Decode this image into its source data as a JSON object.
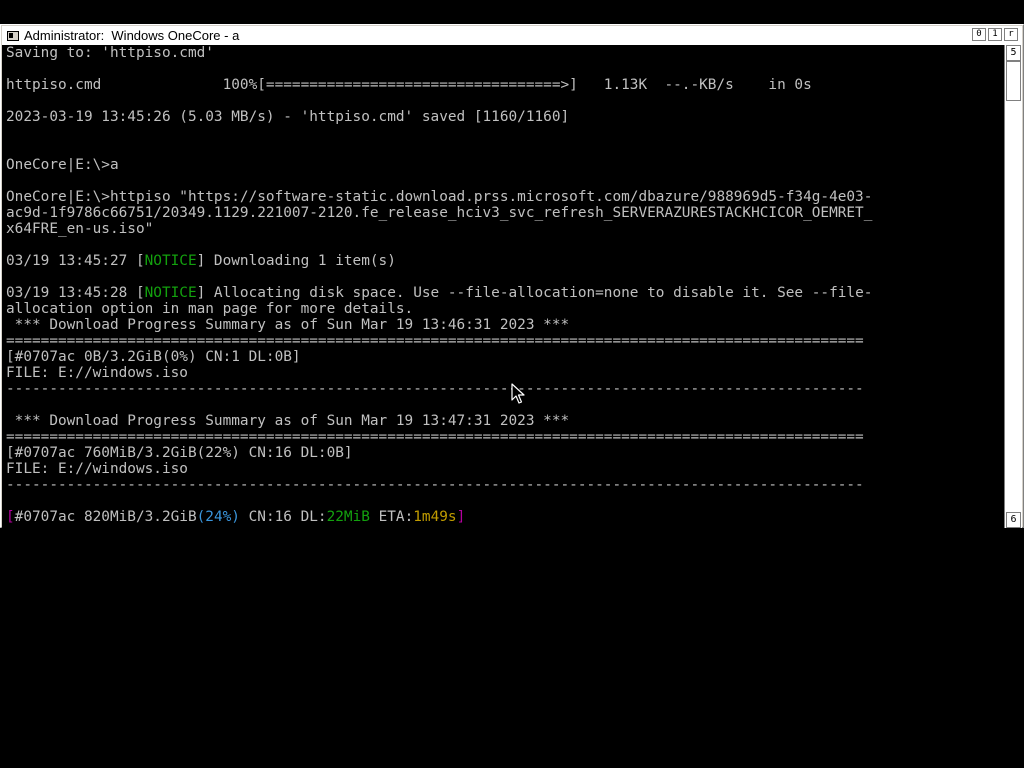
{
  "window": {
    "title": "Administrator:  Windows OneCore - a",
    "buttons": {
      "minimize": "0",
      "maximize": "1",
      "close": "r"
    },
    "scrollbar": {
      "up": "5",
      "down": "6"
    }
  },
  "console": {
    "lines": [
      [
        {
          "t": "Saving to: 'httpiso.cmd'"
        }
      ],
      [
        {
          "t": ""
        }
      ],
      [
        {
          "t": "httpiso.cmd              100%[==================================>]   1.13K  --.-KB/s    in 0s"
        }
      ],
      [
        {
          "t": ""
        }
      ],
      [
        {
          "t": "2023-03-19 13:45:26 (5.03 MB/s) - 'httpiso.cmd' saved [1160/1160]"
        }
      ],
      [
        {
          "t": ""
        }
      ],
      [
        {
          "t": ""
        }
      ],
      [
        {
          "t": "OneCore|E:\\>a"
        }
      ],
      [
        {
          "t": ""
        }
      ],
      [
        {
          "t": "OneCore|E:\\>httpiso \"https://software-static.download.prss.microsoft.com/dbazure/988969d5-f34g-4e03-"
        }
      ],
      [
        {
          "t": "ac9d-1f9786c66751/20349.1129.221007-2120.fe_release_hciv3_svc_refresh_SERVERAZURESTACKHCICOR_OEMRET_"
        }
      ],
      [
        {
          "t": "x64FRE_en-us.iso\""
        }
      ],
      [
        {
          "t": ""
        }
      ],
      [
        {
          "t": "03/19 13:45:27 ["
        },
        {
          "t": "NOTICE",
          "c": "g"
        },
        {
          "t": "] Downloading 1 item(s)"
        }
      ],
      [
        {
          "t": ""
        }
      ],
      [
        {
          "t": "03/19 13:45:28 ["
        },
        {
          "t": "NOTICE",
          "c": "g"
        },
        {
          "t": "] Allocating disk space. Use --file-allocation=none to disable it. See --file-"
        }
      ],
      [
        {
          "t": "allocation option in man page for more details."
        }
      ],
      [
        {
          "t": " *** Download Progress Summary as of Sun Mar 19 13:46:31 2023 ***"
        }
      ],
      [
        {
          "t": "==================================================================================================="
        }
      ],
      [
        {
          "t": "[#0707ac 0B/3.2GiB(0%) CN:1 DL:0B]"
        }
      ],
      [
        {
          "t": "FILE: E://windows.iso"
        }
      ],
      [
        {
          "t": "---------------------------------------------------------------------------------------------------"
        }
      ],
      [
        {
          "t": ""
        }
      ],
      [
        {
          "t": " *** Download Progress Summary as of Sun Mar 19 13:47:31 2023 ***"
        }
      ],
      [
        {
          "t": "==================================================================================================="
        }
      ],
      [
        {
          "t": "[#0707ac 760MiB/3.2GiB(22%) CN:16 DL:0B]"
        }
      ],
      [
        {
          "t": "FILE: E://windows.iso"
        }
      ],
      [
        {
          "t": "---------------------------------------------------------------------------------------------------"
        }
      ],
      [
        {
          "t": ""
        }
      ],
      [
        {
          "t": "[",
          "c": "m"
        },
        {
          "t": "#0707ac 820MiB/3.2GiB"
        },
        {
          "t": "(24%)",
          "c": "c"
        },
        {
          "t": " CN:16 DL:"
        },
        {
          "t": "22MiB",
          "c": "g"
        },
        {
          "t": " ETA:"
        },
        {
          "t": "1m49s",
          "c": "y"
        },
        {
          "t": "]",
          "c": "m"
        }
      ]
    ]
  },
  "colors": {
    "notice": "#13a10e",
    "bracket": "#b4009e",
    "percent": "#3a96dd",
    "eta": "#c19c00",
    "text": "#c0c0c0",
    "background": "#000000"
  },
  "icons": {
    "system_menu": "console-icon",
    "mouse_cursor": "arrow-cursor-icon"
  }
}
